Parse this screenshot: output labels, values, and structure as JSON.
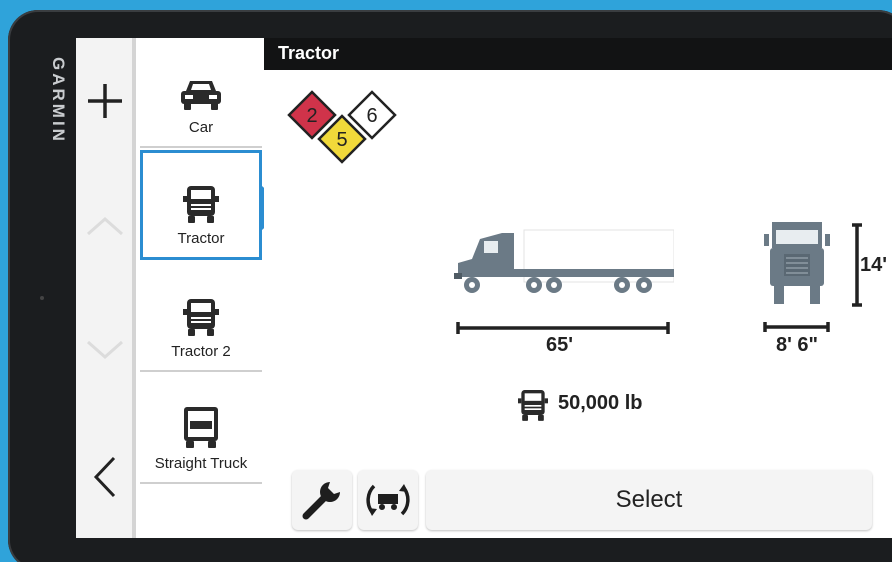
{
  "device": {
    "brand": "GARMIN"
  },
  "rail": {
    "icons": [
      "add-icon",
      "arrow-up-icon",
      "arrow-down-icon",
      "back-icon"
    ]
  },
  "vehicles": [
    {
      "label": "Car",
      "icon": "car-icon",
      "selected": false
    },
    {
      "label": "Tractor",
      "icon": "tractor-icon",
      "selected": true
    },
    {
      "label": "Tractor 2",
      "icon": "tractor-icon",
      "selected": false
    },
    {
      "label": "Straight Truck",
      "icon": "straight-truck-icon",
      "selected": false
    }
  ],
  "detail": {
    "title": "Tractor",
    "hazmat": [
      {
        "value": "2",
        "color": "#d0334a"
      },
      {
        "value": "6",
        "color": "#ffffff"
      },
      {
        "value": "5",
        "color": "#f1d93a"
      }
    ],
    "length": "65'",
    "height": "14'",
    "width": "8' 6\"",
    "weight": "50,000 lb"
  },
  "buttons": {
    "settings_icon": "wrench-icon",
    "swap_icon": "swap-trailer-icon",
    "select_label": "Select"
  },
  "colors": {
    "accent": "#2b8dd1",
    "header_bg": "#121314",
    "truck_cab": "#6b7a86"
  }
}
